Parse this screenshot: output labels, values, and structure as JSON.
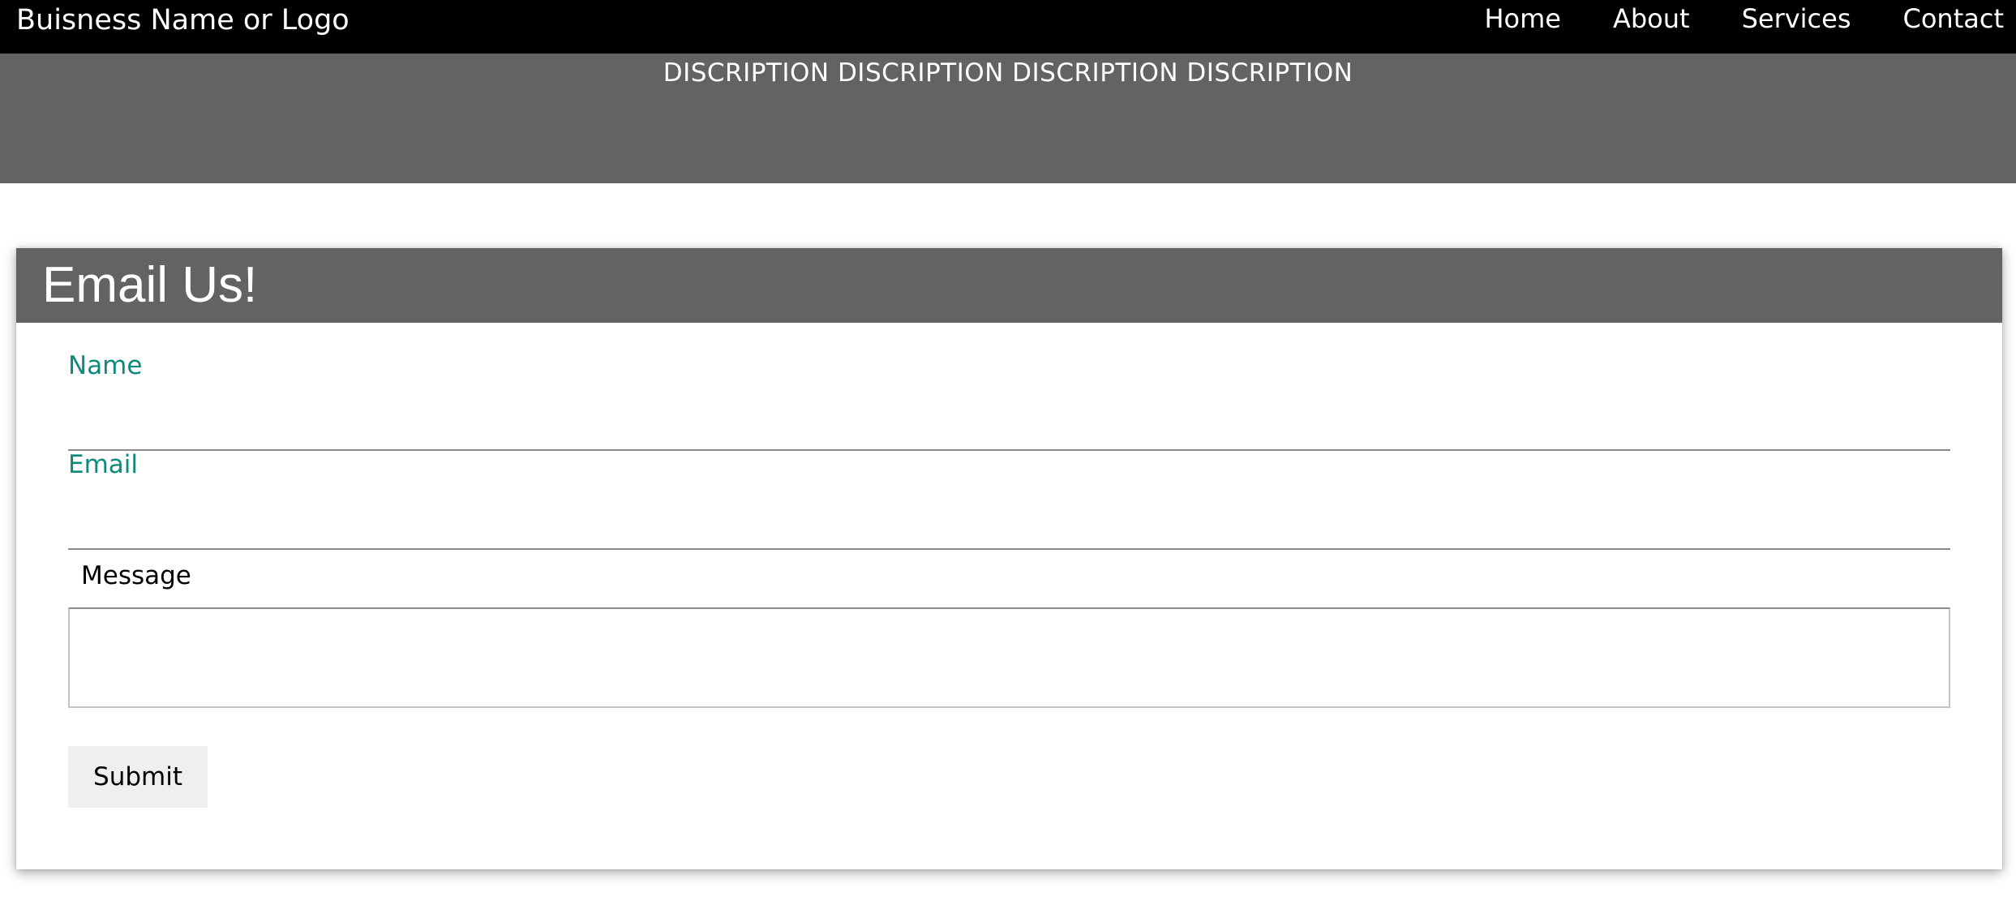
{
  "header": {
    "brand": "Buisness Name or Logo",
    "nav": [
      {
        "label": "Home"
      },
      {
        "label": "About"
      },
      {
        "label": "Services"
      },
      {
        "label": "Contact"
      }
    ]
  },
  "hero": {
    "text": "DISCRIPTION DISCRIPTION DISCRIPTION DISCRIPTION"
  },
  "form": {
    "title": "Email Us!",
    "name_label": "Name",
    "name_value": "",
    "email_label": "Email",
    "email_value": "",
    "message_label": "Message",
    "message_value": "",
    "submit_label": "Submit"
  },
  "colors": {
    "topbar": "#000000",
    "hero_bg": "#636363",
    "card_header_bg": "#636363",
    "label_accent": "#0d8a7c",
    "button_bg": "#efefef"
  }
}
